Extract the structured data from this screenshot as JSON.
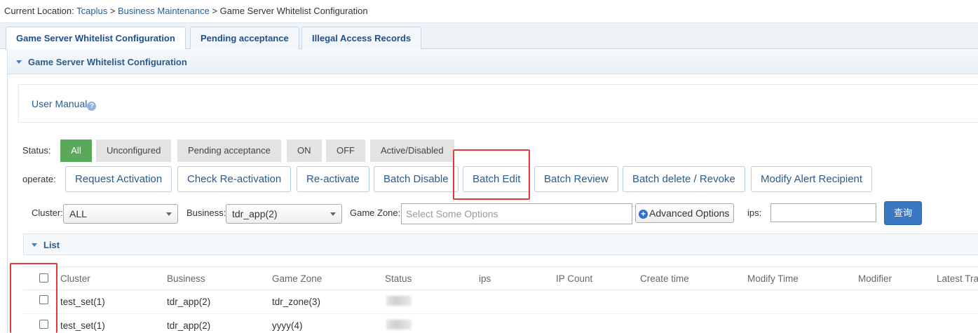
{
  "breadcrumb": {
    "prefix": "Current Location: ",
    "link1": "Tcaplus",
    "sep1": " > ",
    "link2": "Business Maintenance",
    "sep2": " > ",
    "current": "Game Server Whitelist Configuration"
  },
  "tabs": [
    {
      "label": "Game Server Whitelist Configuration",
      "active": true
    },
    {
      "label": "Pending acceptance",
      "active": false
    },
    {
      "label": "Illegal Access Records",
      "active": false
    }
  ],
  "panel": {
    "title": "Game Server Whitelist Configuration"
  },
  "manual": {
    "label": "User Manual",
    "help_glyph": "?"
  },
  "status": {
    "label": "Status:",
    "options": [
      "All",
      "Unconfigured",
      "Pending acceptance",
      "ON",
      "OFF",
      "Active/Disabled"
    ],
    "selected": "All"
  },
  "operate": {
    "label": "operate:",
    "buttons": [
      "Request Activation",
      "Check Re-activation",
      "Re-activate",
      "Batch Disable",
      "Batch Edit",
      "Batch Review",
      "Batch delete / Revoke",
      "Modify Alert Recipient"
    ]
  },
  "filters": {
    "cluster_label": "Cluster:",
    "cluster_value": "ALL",
    "business_label": "Business:",
    "business_value": "tdr_app(2)",
    "zone_label": "Game Zone:",
    "zone_placeholder": "Select Some Options",
    "advanced_label": "Advanced Options",
    "advanced_glyph": "+",
    "ips_label": "ips:",
    "ips_value": "",
    "query_label": "查询"
  },
  "list": {
    "title": "List",
    "columns": [
      "Cluster",
      "Business",
      "Game Zone",
      "Status",
      "ips",
      "IP Count",
      "Create time",
      "Modify Time",
      "Modifier",
      "Latest Tra"
    ],
    "rows": [
      {
        "cluster": "test_set(1)",
        "business": "tdr_app(2)",
        "zone": "tdr_zone(3)"
      },
      {
        "cluster": "test_set(1)",
        "business": "tdr_app(2)",
        "zone": "yyyy(4)"
      }
    ]
  },
  "colors": {
    "accent": "#2b5a8c",
    "link": "#1f5fa8",
    "active_status": "#5aa85a",
    "query_button": "#3a78c3",
    "highlight": "#e53935"
  },
  "icons": [
    "caret-down-icon",
    "help-icon",
    "plus-circle-icon",
    "chevron-down-icon"
  ]
}
